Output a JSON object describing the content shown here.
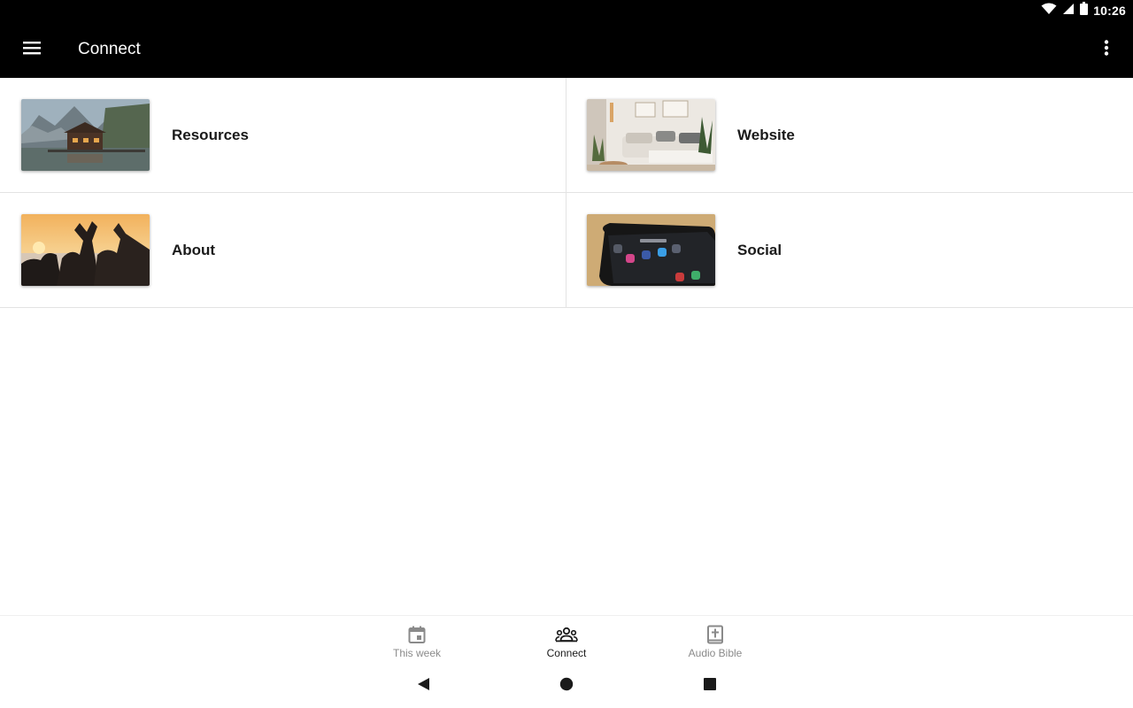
{
  "status_bar": {
    "time": "10:26"
  },
  "app_bar": {
    "title": "Connect"
  },
  "tiles": [
    {
      "label": "Resources",
      "image": "lake-cabin-mountains-photo"
    },
    {
      "label": "Website",
      "image": "living-room-sofa-photo"
    },
    {
      "label": "About",
      "image": "friends-heart-hands-sunset-photo"
    },
    {
      "label": "Social",
      "image": "phone-social-apps-photo"
    }
  ],
  "bottom_nav": {
    "items": [
      {
        "label": "This week",
        "icon": "calendar-icon",
        "active": false
      },
      {
        "label": "Connect",
        "icon": "people-icon",
        "active": true
      },
      {
        "label": "Audio Bible",
        "icon": "bible-icon",
        "active": false
      }
    ]
  },
  "colors": {
    "bar": "#000000",
    "active": "#1a1a1a",
    "inactive": "#8a8a8a",
    "divider": "#e3e3e3"
  }
}
